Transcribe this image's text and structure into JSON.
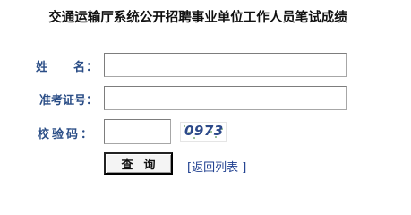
{
  "form": {
    "title": "交通运输厅系统公开招聘事业单位工作人员笔试成绩",
    "name_label_1": "姓",
    "name_label_2": "名：",
    "ticket_label": "准考证号：",
    "code_label": "校验码：",
    "name_value": "",
    "ticket_value": "",
    "code_value": "",
    "captcha_text": "0973",
    "submit_label": "查询",
    "back_link_label": "返回列表",
    "bracket_open": "[",
    "bracket_close": "]"
  },
  "colors": {
    "label": "#2a4d86",
    "link": "#1f3f8f",
    "captcha_text": "#2d4a8a"
  }
}
